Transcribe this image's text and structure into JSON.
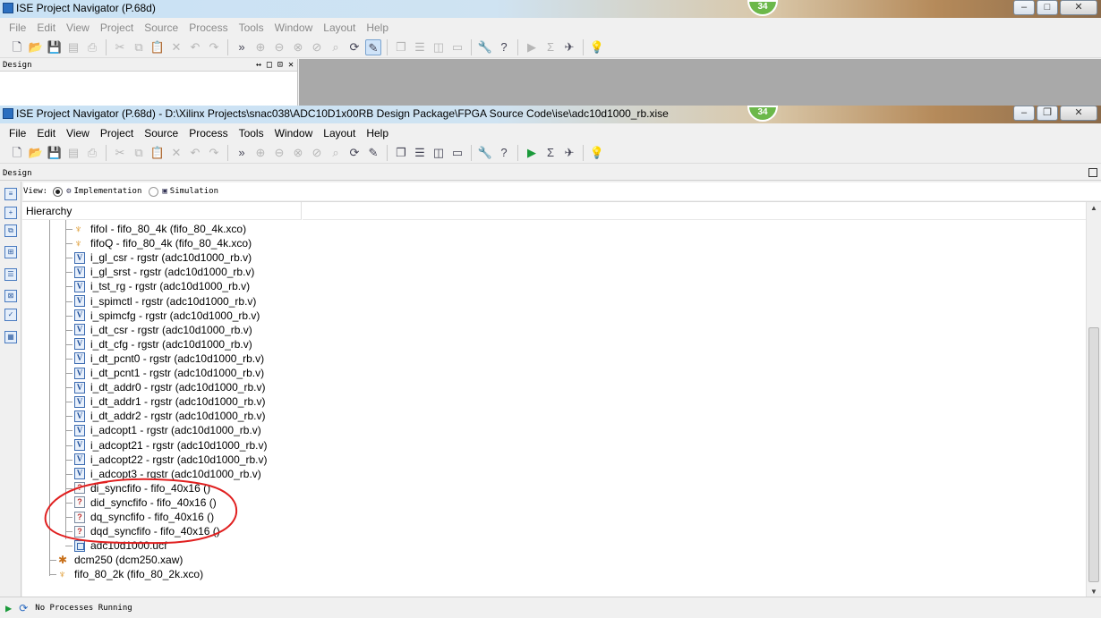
{
  "win1": {
    "title": "ISE Project Navigator (P.68d)",
    "badge": "34",
    "menu": [
      "File",
      "Edit",
      "View",
      "Project",
      "Source",
      "Process",
      "Tools",
      "Window",
      "Layout",
      "Help"
    ],
    "design_label": "Design",
    "panel_controls": "↔ □ ⊡ ✕"
  },
  "win2": {
    "title": "ISE Project Navigator (P.68d) - D:\\Xilinx Projects\\snac038\\ADC10D1x00RB Design Package\\FPGA Source Code\\ise\\adc10d1000_rb.xise",
    "badge": "34",
    "menu": [
      "File",
      "Edit",
      "View",
      "Project",
      "Source",
      "Process",
      "Tools",
      "Window",
      "Layout",
      "Help"
    ],
    "design_label": "Design",
    "view_label": "View:",
    "impl_label": "Implementation",
    "sim_label": "Simulation",
    "hierarchy_header": "Hierarchy",
    "tree": [
      {
        "icon": "core",
        "label": "fifoI - fifo_80_4k (fifo_80_4k.xco)"
      },
      {
        "icon": "core",
        "label": "fifoQ - fifo_80_4k (fifo_80_4k.xco)"
      },
      {
        "icon": "v",
        "label": "i_gl_csr - rgstr (adc10d1000_rb.v)"
      },
      {
        "icon": "v",
        "label": "i_gl_srst - rgstr (adc10d1000_rb.v)"
      },
      {
        "icon": "v",
        "label": "i_tst_rg - rgstr (adc10d1000_rb.v)"
      },
      {
        "icon": "v",
        "label": "i_spimctl - rgstr (adc10d1000_rb.v)"
      },
      {
        "icon": "v",
        "label": "i_spimcfg - rgstr (adc10d1000_rb.v)"
      },
      {
        "icon": "v",
        "label": "i_dt_csr - rgstr (adc10d1000_rb.v)"
      },
      {
        "icon": "v",
        "label": "i_dt_cfg - rgstr (adc10d1000_rb.v)"
      },
      {
        "icon": "v",
        "label": "i_dt_pcnt0 - rgstr (adc10d1000_rb.v)"
      },
      {
        "icon": "v",
        "label": "i_dt_pcnt1 - rgstr (adc10d1000_rb.v)"
      },
      {
        "icon": "v",
        "label": "i_dt_addr0 - rgstr (adc10d1000_rb.v)"
      },
      {
        "icon": "v",
        "label": "i_dt_addr1 - rgstr (adc10d1000_rb.v)"
      },
      {
        "icon": "v",
        "label": "i_dt_addr2 - rgstr (adc10d1000_rb.v)"
      },
      {
        "icon": "v",
        "label": "i_adcopt1 - rgstr (adc10d1000_rb.v)"
      },
      {
        "icon": "v",
        "label": "i_adcopt21 - rgstr (adc10d1000_rb.v)"
      },
      {
        "icon": "v",
        "label": "i_adcopt22 - rgstr (adc10d1000_rb.v)"
      },
      {
        "icon": "v",
        "label": "i_adcopt3 - rgstr (adc10d1000_rb.v)"
      },
      {
        "icon": "q",
        "label": "di_syncfifo - fifo_40x16 ()"
      },
      {
        "icon": "q",
        "label": "did_syncfifo - fifo_40x16 ()"
      },
      {
        "icon": "q",
        "label": "dq_syncfifo - fifo_40x16 ()"
      },
      {
        "icon": "q",
        "label": "dqd_syncfifo - fifo_40x16 ()"
      },
      {
        "icon": "ucf",
        "label": "adc10d1000.ucf"
      },
      {
        "icon": "dcm",
        "label": "dcm250 (dcm250.xaw)"
      },
      {
        "icon": "core",
        "label": "fifo_80_2k (fifo_80_2k.xco)"
      }
    ],
    "status": "No Processes Running"
  },
  "colors": {
    "annotation": "#e02020",
    "selection": "#cfe3f8"
  }
}
